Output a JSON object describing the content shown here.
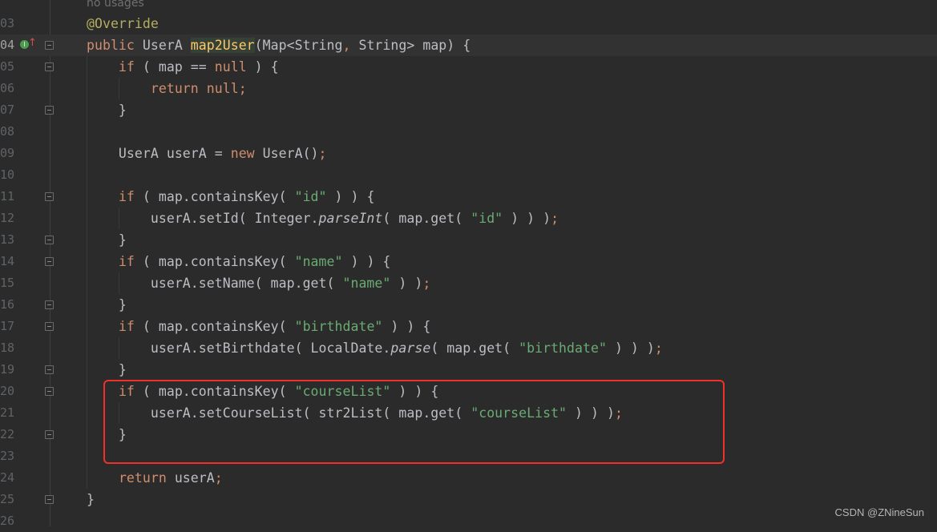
{
  "editor": {
    "current_line": "04",
    "hint": "no usages",
    "lines": [
      {
        "num": "03",
        "fold": false,
        "tokens": [
          {
            "c": "a",
            "t": "@Override"
          }
        ]
      },
      {
        "num": "04",
        "fold": true,
        "icons": true,
        "tokens": [
          {
            "c": "k",
            "t": "public "
          },
          {
            "c": "",
            "t": "UserA "
          },
          {
            "c": "m",
            "t": "map2User"
          },
          {
            "c": "",
            "t": "(Map<String"
          },
          {
            "c": "k",
            "t": ","
          },
          {
            "c": "",
            "t": " String> map) {"
          }
        ]
      },
      {
        "num": "05",
        "fold": true,
        "tokens": [
          {
            "c": "",
            "t": "    "
          },
          {
            "c": "k",
            "t": "if"
          },
          {
            "c": "",
            "t": " ( map == "
          },
          {
            "c": "k",
            "t": "null"
          },
          {
            "c": "",
            "t": " ) {"
          }
        ]
      },
      {
        "num": "06",
        "fold": false,
        "tokens": [
          {
            "c": "",
            "t": "        "
          },
          {
            "c": "k",
            "t": "return null;"
          }
        ]
      },
      {
        "num": "07",
        "fold": true,
        "tokens": [
          {
            "c": "",
            "t": "    }"
          }
        ]
      },
      {
        "num": "08",
        "fold": false,
        "tokens": []
      },
      {
        "num": "09",
        "fold": false,
        "tokens": [
          {
            "c": "",
            "t": "    UserA userA = "
          },
          {
            "c": "k",
            "t": "new"
          },
          {
            "c": "",
            "t": " UserA()"
          },
          {
            "c": "k",
            "t": ";"
          }
        ]
      },
      {
        "num": "10",
        "fold": false,
        "tokens": []
      },
      {
        "num": "11",
        "fold": true,
        "tokens": [
          {
            "c": "",
            "t": "    "
          },
          {
            "c": "k",
            "t": "if"
          },
          {
            "c": "",
            "t": " ( map.containsKey( "
          },
          {
            "c": "s",
            "t": "\"id\""
          },
          {
            "c": "",
            "t": " ) ) {"
          }
        ]
      },
      {
        "num": "12",
        "fold": false,
        "tokens": [
          {
            "c": "",
            "t": "        userA.setId( Integer."
          },
          {
            "c": "i",
            "t": "parseInt"
          },
          {
            "c": "",
            "t": "( map.get( "
          },
          {
            "c": "s",
            "t": "\"id\""
          },
          {
            "c": "",
            "t": " ) ) )"
          },
          {
            "c": "k",
            "t": ";"
          }
        ]
      },
      {
        "num": "13",
        "fold": true,
        "tokens": [
          {
            "c": "",
            "t": "    }"
          }
        ]
      },
      {
        "num": "14",
        "fold": true,
        "tokens": [
          {
            "c": "",
            "t": "    "
          },
          {
            "c": "k",
            "t": "if"
          },
          {
            "c": "",
            "t": " ( map.containsKey( "
          },
          {
            "c": "s",
            "t": "\"name\""
          },
          {
            "c": "",
            "t": " ) ) {"
          }
        ]
      },
      {
        "num": "15",
        "fold": false,
        "tokens": [
          {
            "c": "",
            "t": "        userA.setName( map.get( "
          },
          {
            "c": "s",
            "t": "\"name\""
          },
          {
            "c": "",
            "t": " ) )"
          },
          {
            "c": "k",
            "t": ";"
          }
        ]
      },
      {
        "num": "16",
        "fold": true,
        "tokens": [
          {
            "c": "",
            "t": "    }"
          }
        ]
      },
      {
        "num": "17",
        "fold": true,
        "tokens": [
          {
            "c": "",
            "t": "    "
          },
          {
            "c": "k",
            "t": "if"
          },
          {
            "c": "",
            "t": " ( map.containsKey( "
          },
          {
            "c": "s",
            "t": "\"birthdate\""
          },
          {
            "c": "",
            "t": " ) ) {"
          }
        ]
      },
      {
        "num": "18",
        "fold": false,
        "tokens": [
          {
            "c": "",
            "t": "        userA.setBirthdate( LocalDate."
          },
          {
            "c": "i",
            "t": "parse"
          },
          {
            "c": "",
            "t": "( map.get( "
          },
          {
            "c": "s",
            "t": "\"birthdate\""
          },
          {
            "c": "",
            "t": " ) ) )"
          },
          {
            "c": "k",
            "t": ";"
          }
        ]
      },
      {
        "num": "19",
        "fold": true,
        "tokens": [
          {
            "c": "",
            "t": "    }"
          }
        ]
      },
      {
        "num": "20",
        "fold": true,
        "tokens": [
          {
            "c": "",
            "t": "    "
          },
          {
            "c": "k",
            "t": "if"
          },
          {
            "c": "",
            "t": " ( map.containsKey( "
          },
          {
            "c": "s",
            "t": "\"courseList\""
          },
          {
            "c": "",
            "t": " ) ) {"
          }
        ]
      },
      {
        "num": "21",
        "fold": false,
        "tokens": [
          {
            "c": "",
            "t": "        userA.setCourseList( str2List( map.get( "
          },
          {
            "c": "s",
            "t": "\"courseList\""
          },
          {
            "c": "",
            "t": " ) ) )"
          },
          {
            "c": "k",
            "t": ";"
          }
        ]
      },
      {
        "num": "22",
        "fold": true,
        "tokens": [
          {
            "c": "",
            "t": "    }"
          }
        ]
      },
      {
        "num": "23",
        "fold": false,
        "tokens": []
      },
      {
        "num": "24",
        "fold": false,
        "tokens": [
          {
            "c": "",
            "t": "    "
          },
          {
            "c": "k",
            "t": "return"
          },
          {
            "c": "",
            "t": " userA"
          },
          {
            "c": "k",
            "t": ";"
          }
        ]
      },
      {
        "num": "25",
        "fold": true,
        "tokens": [
          {
            "c": "",
            "t": "}"
          }
        ]
      },
      {
        "num": "26",
        "fold": false,
        "tokens": []
      }
    ]
  },
  "highlight_color": "#f0302a",
  "watermark": "CSDN @ZNineSun"
}
